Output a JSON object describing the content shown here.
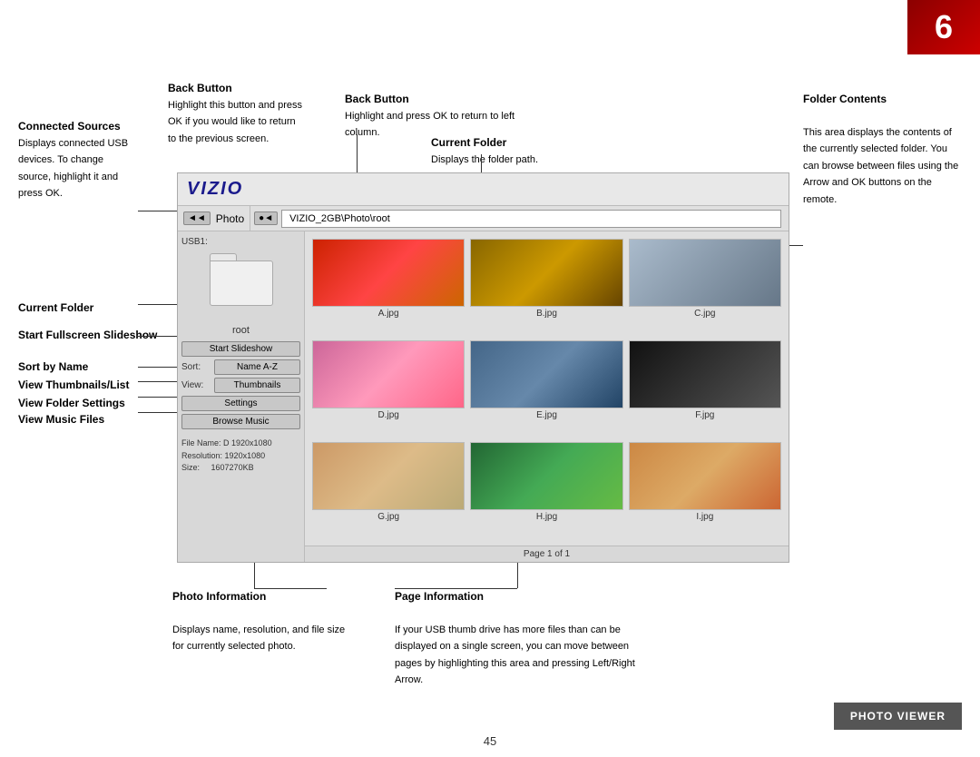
{
  "page": {
    "number": "6",
    "page_num": "45"
  },
  "top_annotations": {
    "back_button_left": {
      "title": "Back Button",
      "desc": "Highlight this button and press OK if you would like to return to the previous screen."
    },
    "back_button_right": {
      "title": "Back Button",
      "desc": "Highlight and press OK to return to left column."
    },
    "current_folder_top": {
      "title": "Current Folder",
      "desc": "Displays the folder path."
    }
  },
  "left_annotations": {
    "connected_sources": {
      "title": "Connected Sources",
      "desc": "Displays connected USB devices. To change source, highlight it and press OK."
    },
    "current_folder": {
      "title": "Current Folder"
    },
    "start_fullscreen": {
      "title": "Start Fullscreen Slideshow"
    },
    "sort_by_name": {
      "title": "Sort by Name"
    },
    "view_thumbnails": {
      "title": "View Thumbnails/List"
    },
    "view_folder_settings": {
      "title": "View Folder Settings"
    },
    "view_music_files": {
      "title": "View Music Files"
    }
  },
  "bottom_annotations": {
    "photo_information": {
      "title": "Photo Information",
      "desc": "Displays name, resolution, and file size for currently selected photo."
    },
    "page_information": {
      "title": "Page Information",
      "desc": "If your USB thumb drive has more files than can be displayed on a single screen, you can move between pages by highlighting this area and pressing Left/Right Arrow."
    }
  },
  "right_annotation": {
    "folder_contents": {
      "title": "Folder Contents",
      "desc": "This area displays the contents of the currently selected folder. You can browse between files using the Arrow and OK buttons on the remote."
    }
  },
  "vizio_panel": {
    "logo": "VIZIO",
    "nav_back_left": "◄◄",
    "nav_label_left": "Photo",
    "nav_back_right": "●◄",
    "nav_path": "VIZIO_2GB\\Photo\\root",
    "usb_label": "USB1:",
    "folder_name": "root",
    "controls": {
      "slideshow_btn": "Start Slideshow",
      "sort_label": "Sort:",
      "sort_btn": "Name A-Z",
      "view_label": "View:",
      "view_btn": "Thumbnails",
      "settings_btn": "Settings",
      "music_btn": "Browse Music"
    },
    "file_info": {
      "name_label": "File Name:",
      "name_value": "D 1920x1080",
      "resolution_label": "Resolution:",
      "resolution_value": "1920x1080",
      "size_label": "Size:",
      "size_value": "1607270KB"
    },
    "photos": [
      {
        "id": "A",
        "label": "A.jpg",
        "color_class": "photo-a"
      },
      {
        "id": "B",
        "label": "B.jpg",
        "color_class": "photo-b"
      },
      {
        "id": "C",
        "label": "C.jpg",
        "color_class": "photo-c"
      },
      {
        "id": "D",
        "label": "D.jpg",
        "color_class": "photo-d"
      },
      {
        "id": "E",
        "label": "E.jpg",
        "color_class": "photo-e"
      },
      {
        "id": "F",
        "label": "F.jpg",
        "color_class": "photo-f"
      },
      {
        "id": "G",
        "label": "G.jpg",
        "color_class": "photo-g"
      },
      {
        "id": "H",
        "label": "H.jpg",
        "color_class": "photo-h"
      },
      {
        "id": "I",
        "label": "I.jpg",
        "color_class": "photo-i"
      }
    ],
    "page_info": "Page 1 of 1"
  },
  "badges": {
    "photo_viewer": "PHOTO VIEWER"
  }
}
